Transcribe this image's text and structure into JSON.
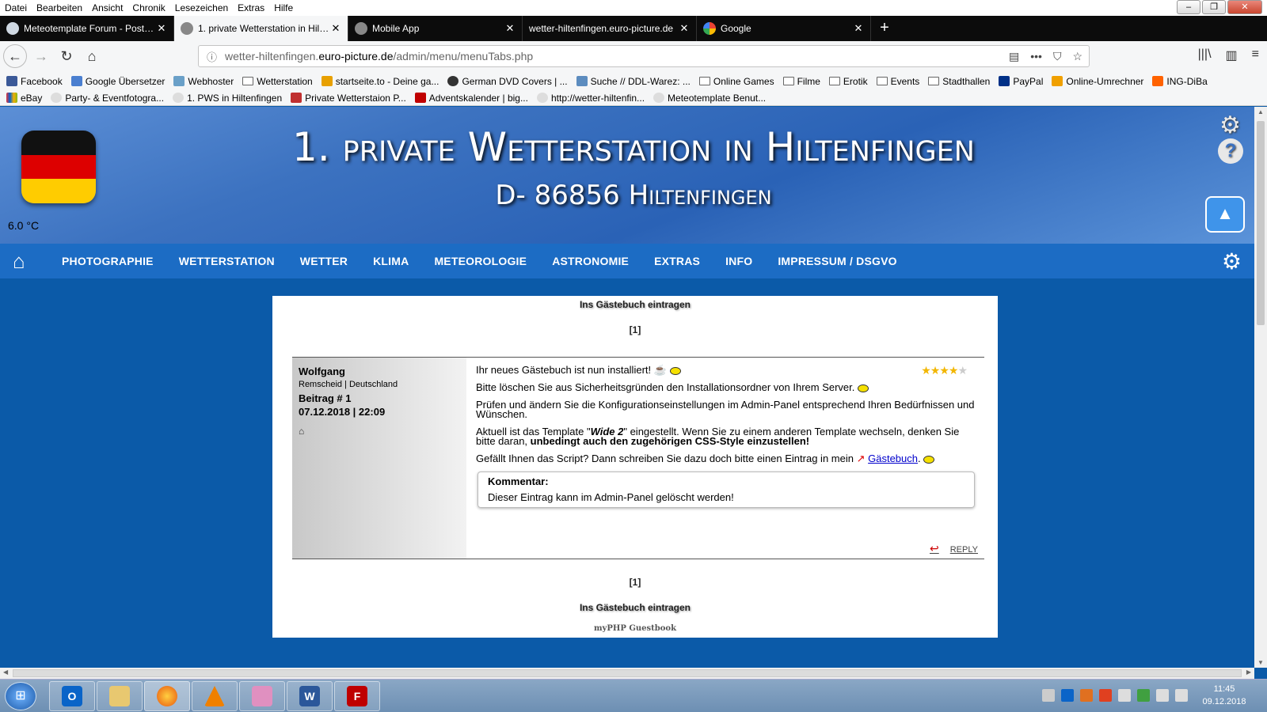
{
  "menubar": [
    "Datei",
    "Bearbeiten",
    "Ansicht",
    "Chronik",
    "Lesezeichen",
    "Extras",
    "Hilfe"
  ],
  "tabs": [
    {
      "label": "Meteotemplate Forum - Post a reply",
      "active": false
    },
    {
      "label": "1. private Wetterstation in Hiltenfingen",
      "active": true
    },
    {
      "label": "Mobile App",
      "active": false
    },
    {
      "label": "wetter-hiltenfingen.euro-picture.de",
      "active": false
    },
    {
      "label": "Google",
      "active": false
    }
  ],
  "url": {
    "prefix": "wetter-hiltenfingen.",
    "domain": "euro-picture.de",
    "path": "/admin/menu/menuTabs.php"
  },
  "bookmarks_row1": [
    "Facebook",
    "Google Übersetzer",
    "Webhoster",
    "Wetterstation",
    "startseite.to - Deine ga...",
    "German DVD Covers | ...",
    "Suche // DDL-Warez: ...",
    "Online Games",
    "Filme",
    "Erotik",
    "Events",
    "Stadthallen",
    "PayPal",
    "Online-Umrechner",
    "ING-DiBa"
  ],
  "bookmarks_row2": [
    "eBay",
    "Party- & Eventfotogra...",
    "1. PWS in Hiltenfingen",
    "Private Wetterstaion P...",
    "Adventskalender | big...",
    "http://wetter-hiltenfin...",
    "Meteotemplate Benut..."
  ],
  "header": {
    "title": "1. private Wetterstation in Hiltenfingen",
    "subtitle": "D- 86856 Hiltenfingen",
    "temperature": "6.0 °C",
    "flag_colors": [
      "#111111",
      "#dd0000",
      "#ffcc00"
    ]
  },
  "mainnav": [
    "PHOTOGRAPHIE",
    "WETTERSTATION",
    "WETTER",
    "KLIMA",
    "METEOROLOGIE",
    "ASTRONOMIE",
    "EXTRAS",
    "INFO",
    "IMPRESSUM / DSGVO"
  ],
  "guestbook": {
    "sign_link": "Ins Gästebuch eintragen",
    "pager": "[1]",
    "footer": "myPHP Guestbook",
    "entry": {
      "author": "Wolfgang",
      "origin": "Remscheid | Deutschland",
      "post_no": "Beitrag # 1",
      "date": "07.12.2018 | 22:09",
      "rating": 4,
      "rating_max": 5,
      "p1": "Ihr neues Gästebuch ist nun installiert!",
      "p2": "Bitte löschen Sie aus Sicherheitsgründen den Installationsordner von Ihrem Server.",
      "p3": "Prüfen und ändern Sie die Konfigurationseinstellungen im Admin-Panel entsprechend Ihren Bedürfnissen und Wünschen.",
      "p4a": "Aktuell ist das Template \"",
      "p4b": "Wide 2",
      "p4c": "\" eingestellt. Wenn Sie zu einem anderen Template wechseln, denken Sie bitte daran, ",
      "p4d": "unbedingt auch den zugehörigen CSS-Style einzustellen!",
      "p5a": "Gefällt Ihnen das Script? Dann schreiben Sie dazu doch bitte einen Eintrag in mein",
      "p5link": "Gästebuch",
      "comment_heading": "Kommentar:",
      "comment_text": "Dieser Eintrag kann im Admin-Panel gelöscht werden!",
      "reply": "REPLY"
    }
  },
  "clock": {
    "time": "11:45",
    "date": "09.12.2018"
  }
}
